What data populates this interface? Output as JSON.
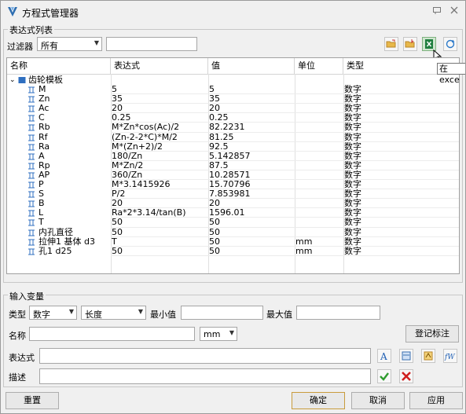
{
  "window": {
    "title": "方程式管理器",
    "pin_icon": "pin-icon",
    "close_icon": "close-icon"
  },
  "expr_list": {
    "group_label": "表达式列表",
    "filter_label": "过滤器",
    "filter_value": "所有",
    "filter_text": "",
    "toolbar_icons": [
      "open-folder-icon",
      "import-icon",
      "excel-export-icon",
      "refresh-icon"
    ],
    "tooltip": "在exce"
  },
  "table": {
    "headers": [
      "名称",
      "表达式",
      "值",
      "单位",
      "类型"
    ],
    "group_name": "齿轮模板",
    "rows": [
      {
        "name": "M",
        "expr": "5",
        "value": "5",
        "unit": "",
        "type": "数字"
      },
      {
        "name": "Zn",
        "expr": "35",
        "value": "35",
        "unit": "",
        "type": "数字"
      },
      {
        "name": "Ac",
        "expr": "20",
        "value": "20",
        "unit": "",
        "type": "数字"
      },
      {
        "name": "C",
        "expr": "0.25",
        "value": "0.25",
        "unit": "",
        "type": "数字"
      },
      {
        "name": "Rb",
        "expr": "M*Zn*cos(Ac)/2",
        "value": "82.2231",
        "unit": "",
        "type": "数字"
      },
      {
        "name": "Rf",
        "expr": "(Zn-2-2*C)*M/2",
        "value": "81.25",
        "unit": "",
        "type": "数字"
      },
      {
        "name": "Ra",
        "expr": "M*(Zn+2)/2",
        "value": "92.5",
        "unit": "",
        "type": "数字"
      },
      {
        "name": "A",
        "expr": "180/Zn",
        "value": "5.142857",
        "unit": "",
        "type": "数字"
      },
      {
        "name": "Rp",
        "expr": "M*Zn/2",
        "value": "87.5",
        "unit": "",
        "type": "数字"
      },
      {
        "name": "AP",
        "expr": "360/Zn",
        "value": "10.28571",
        "unit": "",
        "type": "数字"
      },
      {
        "name": "P",
        "expr": "M*3.1415926",
        "value": "15.70796",
        "unit": "",
        "type": "数字"
      },
      {
        "name": "S",
        "expr": "P/2",
        "value": "7.853981",
        "unit": "",
        "type": "数字"
      },
      {
        "name": "B",
        "expr": "20",
        "value": "20",
        "unit": "",
        "type": "数字"
      },
      {
        "name": "L",
        "expr": "Ra*2*3.14/tan(B)",
        "value": "1596.01",
        "unit": "",
        "type": "数字"
      },
      {
        "name": "T",
        "expr": "50",
        "value": "50",
        "unit": "",
        "type": "数字"
      },
      {
        "name": "内孔直径",
        "expr": "50",
        "value": "50",
        "unit": "",
        "type": "数字"
      },
      {
        "name": "拉伸1 基体 d3",
        "expr": "T",
        "value": "50",
        "unit": "mm",
        "type": "数字"
      },
      {
        "name": "孔1 d25",
        "expr": "50",
        "value": "50",
        "unit": "mm",
        "type": "数字"
      }
    ]
  },
  "input": {
    "group_label": "输入变量",
    "type_label": "类型",
    "type_value": "数字",
    "unit_kind_value": "长度",
    "min_label": "最小值",
    "min_value": "",
    "max_label": "最大值",
    "max_value": "",
    "name_label": "名称",
    "name_value": "",
    "unit_value": "mm",
    "register_button": "登记标注",
    "expr_label": "表达式",
    "expr_value": "",
    "desc_label": "描述",
    "desc_value": ""
  },
  "footer": {
    "reset": "重置",
    "ok": "确定",
    "cancel": "取消",
    "apply": "应用"
  },
  "colors": {
    "accent_blue": "#1f5fb4",
    "ok_green": "#2e9b2e",
    "cancel_red": "#d02020"
  }
}
